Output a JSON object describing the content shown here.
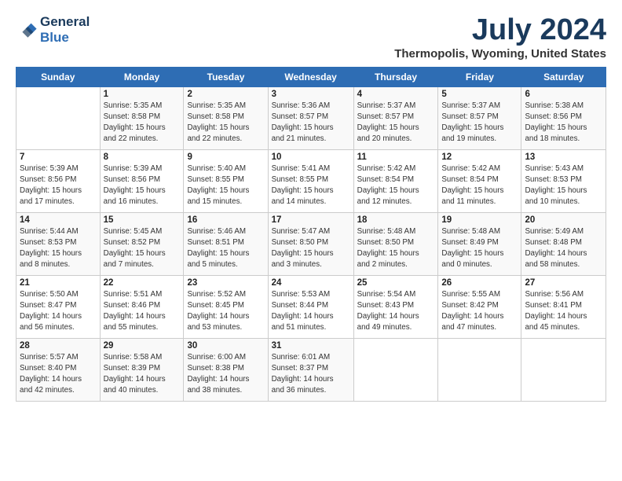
{
  "header": {
    "logo_line1": "General",
    "logo_line2": "Blue",
    "month_year": "July 2024",
    "location": "Thermopolis, Wyoming, United States"
  },
  "calendar": {
    "days_of_week": [
      "Sunday",
      "Monday",
      "Tuesday",
      "Wednesday",
      "Thursday",
      "Friday",
      "Saturday"
    ],
    "weeks": [
      [
        {
          "num": "",
          "info": ""
        },
        {
          "num": "1",
          "info": "Sunrise: 5:35 AM\nSunset: 8:58 PM\nDaylight: 15 hours\nand 22 minutes."
        },
        {
          "num": "2",
          "info": "Sunrise: 5:35 AM\nSunset: 8:58 PM\nDaylight: 15 hours\nand 22 minutes."
        },
        {
          "num": "3",
          "info": "Sunrise: 5:36 AM\nSunset: 8:57 PM\nDaylight: 15 hours\nand 21 minutes."
        },
        {
          "num": "4",
          "info": "Sunrise: 5:37 AM\nSunset: 8:57 PM\nDaylight: 15 hours\nand 20 minutes."
        },
        {
          "num": "5",
          "info": "Sunrise: 5:37 AM\nSunset: 8:57 PM\nDaylight: 15 hours\nand 19 minutes."
        },
        {
          "num": "6",
          "info": "Sunrise: 5:38 AM\nSunset: 8:56 PM\nDaylight: 15 hours\nand 18 minutes."
        }
      ],
      [
        {
          "num": "7",
          "info": "Sunrise: 5:39 AM\nSunset: 8:56 PM\nDaylight: 15 hours\nand 17 minutes."
        },
        {
          "num": "8",
          "info": "Sunrise: 5:39 AM\nSunset: 8:56 PM\nDaylight: 15 hours\nand 16 minutes."
        },
        {
          "num": "9",
          "info": "Sunrise: 5:40 AM\nSunset: 8:55 PM\nDaylight: 15 hours\nand 15 minutes."
        },
        {
          "num": "10",
          "info": "Sunrise: 5:41 AM\nSunset: 8:55 PM\nDaylight: 15 hours\nand 14 minutes."
        },
        {
          "num": "11",
          "info": "Sunrise: 5:42 AM\nSunset: 8:54 PM\nDaylight: 15 hours\nand 12 minutes."
        },
        {
          "num": "12",
          "info": "Sunrise: 5:42 AM\nSunset: 8:54 PM\nDaylight: 15 hours\nand 11 minutes."
        },
        {
          "num": "13",
          "info": "Sunrise: 5:43 AM\nSunset: 8:53 PM\nDaylight: 15 hours\nand 10 minutes."
        }
      ],
      [
        {
          "num": "14",
          "info": "Sunrise: 5:44 AM\nSunset: 8:53 PM\nDaylight: 15 hours\nand 8 minutes."
        },
        {
          "num": "15",
          "info": "Sunrise: 5:45 AM\nSunset: 8:52 PM\nDaylight: 15 hours\nand 7 minutes."
        },
        {
          "num": "16",
          "info": "Sunrise: 5:46 AM\nSunset: 8:51 PM\nDaylight: 15 hours\nand 5 minutes."
        },
        {
          "num": "17",
          "info": "Sunrise: 5:47 AM\nSunset: 8:50 PM\nDaylight: 15 hours\nand 3 minutes."
        },
        {
          "num": "18",
          "info": "Sunrise: 5:48 AM\nSunset: 8:50 PM\nDaylight: 15 hours\nand 2 minutes."
        },
        {
          "num": "19",
          "info": "Sunrise: 5:48 AM\nSunset: 8:49 PM\nDaylight: 15 hours\nand 0 minutes."
        },
        {
          "num": "20",
          "info": "Sunrise: 5:49 AM\nSunset: 8:48 PM\nDaylight: 14 hours\nand 58 minutes."
        }
      ],
      [
        {
          "num": "21",
          "info": "Sunrise: 5:50 AM\nSunset: 8:47 PM\nDaylight: 14 hours\nand 56 minutes."
        },
        {
          "num": "22",
          "info": "Sunrise: 5:51 AM\nSunset: 8:46 PM\nDaylight: 14 hours\nand 55 minutes."
        },
        {
          "num": "23",
          "info": "Sunrise: 5:52 AM\nSunset: 8:45 PM\nDaylight: 14 hours\nand 53 minutes."
        },
        {
          "num": "24",
          "info": "Sunrise: 5:53 AM\nSunset: 8:44 PM\nDaylight: 14 hours\nand 51 minutes."
        },
        {
          "num": "25",
          "info": "Sunrise: 5:54 AM\nSunset: 8:43 PM\nDaylight: 14 hours\nand 49 minutes."
        },
        {
          "num": "26",
          "info": "Sunrise: 5:55 AM\nSunset: 8:42 PM\nDaylight: 14 hours\nand 47 minutes."
        },
        {
          "num": "27",
          "info": "Sunrise: 5:56 AM\nSunset: 8:41 PM\nDaylight: 14 hours\nand 45 minutes."
        }
      ],
      [
        {
          "num": "28",
          "info": "Sunrise: 5:57 AM\nSunset: 8:40 PM\nDaylight: 14 hours\nand 42 minutes."
        },
        {
          "num": "29",
          "info": "Sunrise: 5:58 AM\nSunset: 8:39 PM\nDaylight: 14 hours\nand 40 minutes."
        },
        {
          "num": "30",
          "info": "Sunrise: 6:00 AM\nSunset: 8:38 PM\nDaylight: 14 hours\nand 38 minutes."
        },
        {
          "num": "31",
          "info": "Sunrise: 6:01 AM\nSunset: 8:37 PM\nDaylight: 14 hours\nand 36 minutes."
        },
        {
          "num": "",
          "info": ""
        },
        {
          "num": "",
          "info": ""
        },
        {
          "num": "",
          "info": ""
        }
      ]
    ]
  }
}
